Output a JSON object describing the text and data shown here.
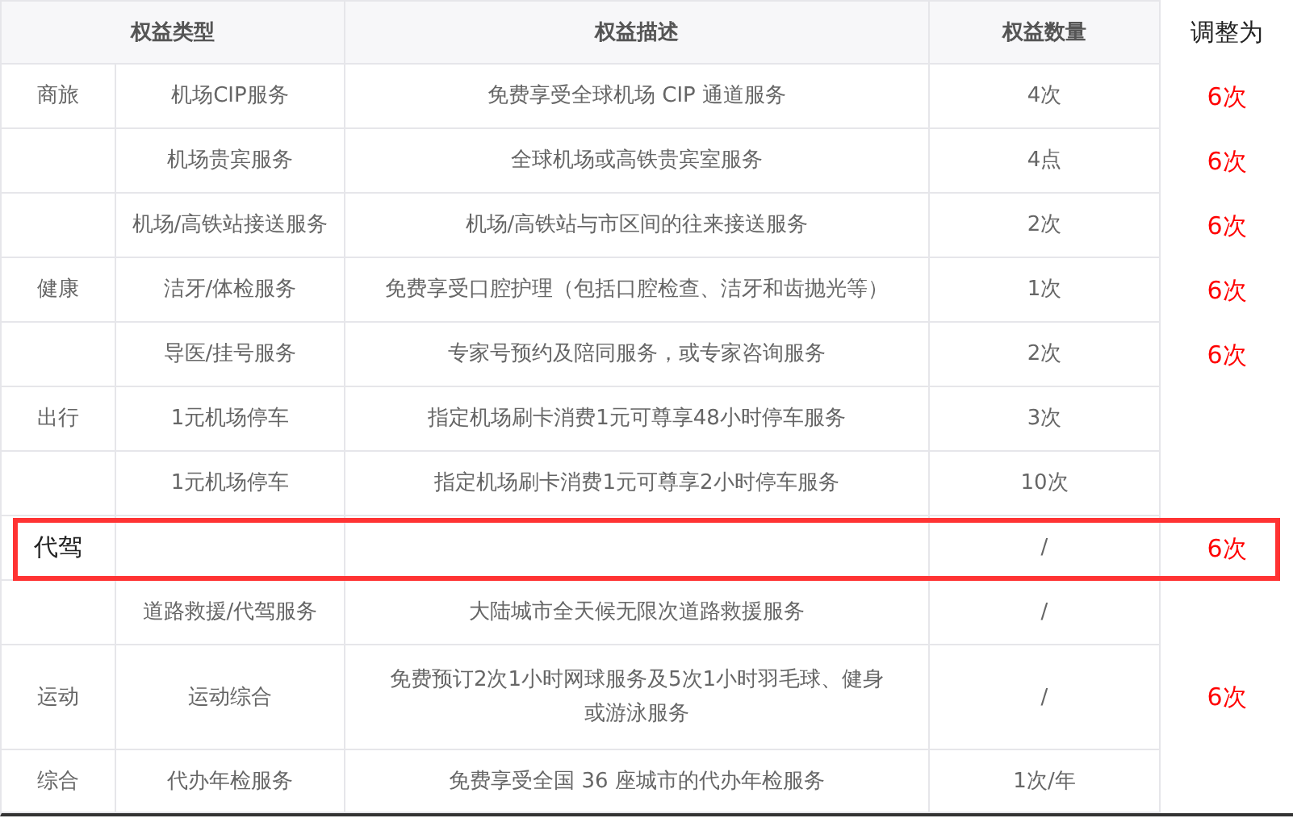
{
  "table": {
    "columns": [
      "权益类型",
      "权益描述",
      "权益数量",
      "调整为"
    ],
    "rows": [
      {
        "category": "商旅",
        "name": "机场CIP服务",
        "description": "免费享受全球机场 CIP 通道服务",
        "quantity": "4次",
        "adjusted": "6次",
        "highlighted": false
      },
      {
        "name": "机场贵宾服务",
        "description": "全球机场或高铁贵宾室服务",
        "quantity": "4点",
        "adjusted": "6次",
        "highlighted": false
      },
      {
        "name": "机场/高铁站接送服务",
        "description": "机场/高铁站与市区间的往来接送服务",
        "quantity": "2次",
        "adjusted": "6次",
        "highlighted": false
      },
      {
        "category": "健康",
        "name": "洁牙/体检服务",
        "description": "免费享受口腔护理（包括口腔检查、洁牙和齿抛光等）",
        "quantity": "1次",
        "adjusted": "6次",
        "highlighted": false
      },
      {
        "name": "导医/挂号服务",
        "description": "专家号预约及陪同服务，或专家咨询服务",
        "quantity": "2次",
        "adjusted": "6次",
        "highlighted": false
      },
      {
        "category": "出行",
        "name": "1元机场停车",
        "description": "指定机场刷卡消费1元可尊享48小时停车服务",
        "quantity": "3次",
        "highlighted": false
      },
      {
        "name": "1元机场停车",
        "description": "指定机场刷卡消费1元可尊享2小时停车服务",
        "quantity": "10次",
        "highlighted": false
      },
      {
        "category": "代驾",
        "quantity": "/",
        "adjusted": "6次",
        "highlighted": true
      },
      {
        "name": "道路救援/代驾服务",
        "description": "大陆城市全天候无限次道路救援服务",
        "quantity": "/",
        "highlighted": false
      },
      {
        "category": "运动",
        "name": "运动综合",
        "description": "免费预订2次1小时网球服务及5次1小时羽毛球、健身或游泳服务",
        "quantity": "/",
        "adjusted": "6次",
        "highlighted": false
      },
      {
        "category": "综合",
        "name": "代办年检服务",
        "description": "免费享受全国 36 座城市的代办年检服务",
        "quantity": "1次/年",
        "highlighted": false
      }
    ]
  }
}
